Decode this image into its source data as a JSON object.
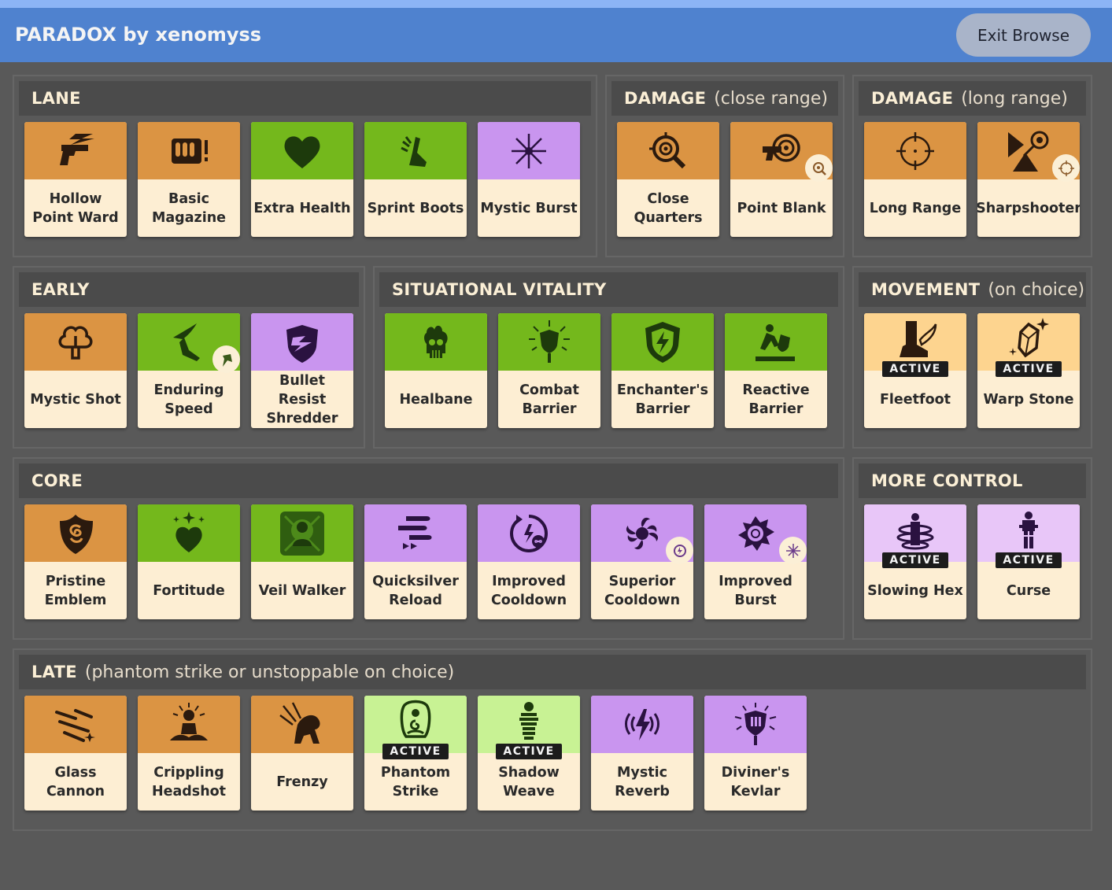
{
  "header": {
    "title": "PARADOX by xenomyss",
    "exit_label": "Exit Browse"
  },
  "active_label": "ACTIVE",
  "sections": {
    "lane": {
      "name": "LANE",
      "note": ""
    },
    "damage_close": {
      "name": "DAMAGE",
      "note": "(close range)"
    },
    "damage_long": {
      "name": "DAMAGE",
      "note": "(long range)"
    },
    "early": {
      "name": "EARLY",
      "note": ""
    },
    "situational": {
      "name": "SITUATIONAL VITALITY",
      "note": ""
    },
    "movement": {
      "name": "MOVEMENT",
      "note": "(on choice)"
    },
    "core": {
      "name": "CORE",
      "note": ""
    },
    "more_control": {
      "name": "MORE CONTROL",
      "note": ""
    },
    "late": {
      "name": "LATE",
      "note": "(phantom strike or unstoppable on choice)"
    }
  },
  "items": {
    "hollow_point_ward": {
      "name": "Hollow Point Ward",
      "category": "orange",
      "icon": "pistol-lightning-icon"
    },
    "basic_magazine": {
      "name": "Basic Magazine",
      "category": "orange",
      "icon": "magazine-icon"
    },
    "extra_health": {
      "name": "Extra Health",
      "category": "green",
      "icon": "heart-icon"
    },
    "sprint_boots": {
      "name": "Sprint Boots",
      "category": "green",
      "icon": "boot-icon"
    },
    "mystic_burst": {
      "name": "Mystic Burst",
      "category": "purple",
      "icon": "starburst-icon"
    },
    "close_quarters": {
      "name": "Close Quarters",
      "category": "orange",
      "icon": "magnifier-target-icon"
    },
    "point_blank": {
      "name": "Point Blank",
      "category": "orange",
      "icon": "gun-target-icon"
    },
    "long_range": {
      "name": "Long Range",
      "category": "orange",
      "icon": "crosshair-icon"
    },
    "sharpshooter": {
      "name": "Sharpshooter",
      "category": "orange",
      "icon": "sharpshooter-icon"
    },
    "mystic_shot": {
      "name": "Mystic Shot",
      "category": "orange",
      "icon": "mystic-shot-icon"
    },
    "enduring_speed": {
      "name": "Enduring Speed",
      "category": "green",
      "icon": "winged-foot-icon"
    },
    "bullet_resist_shredder": {
      "name": "Bullet Resist Shredder",
      "category": "purple",
      "icon": "broken-shield-icon"
    },
    "healbane": {
      "name": "Healbane",
      "category": "green",
      "icon": "skull-icon"
    },
    "combat_barrier": {
      "name": "Combat Barrier",
      "category": "green",
      "icon": "radiant-shield-icon"
    },
    "enchanters_barrier": {
      "name": "Enchanter's Barrier",
      "category": "green",
      "icon": "lightning-shield-icon"
    },
    "reactive_barrier": {
      "name": "Reactive Barrier",
      "category": "green",
      "icon": "falling-figure-icon"
    },
    "fleetfoot": {
      "name": "Fleetfoot",
      "category": "lightorange",
      "icon": "winged-boot-icon",
      "active": true
    },
    "warp_stone": {
      "name": "Warp Stone",
      "category": "lightorange",
      "icon": "warp-crystal-icon",
      "active": true
    },
    "pristine_emblem": {
      "name": "Pristine Emblem",
      "category": "orange",
      "icon": "emblem-shield-icon"
    },
    "fortitude": {
      "name": "Fortitude",
      "category": "green",
      "icon": "sparkle-heart-icon"
    },
    "veil_walker": {
      "name": "Veil Walker",
      "category": "green",
      "icon": "veiled-figure-icon"
    },
    "quicksilver_reload": {
      "name": "Quicksilver Reload",
      "category": "purple",
      "icon": "speeding-bullets-icon"
    },
    "improved_cooldown": {
      "name": "Improved Cooldown",
      "category": "purple",
      "icon": "cooldown-icon"
    },
    "superior_cooldown": {
      "name": "Superior Cooldown",
      "category": "purple",
      "icon": "swirl-cooldown-icon"
    },
    "improved_burst": {
      "name": "Improved Burst",
      "category": "purple",
      "icon": "burst-ring-icon"
    },
    "slowing_hex": {
      "name": "Slowing Hex",
      "category": "lightpurple",
      "icon": "hexed-figure-icon",
      "active": true
    },
    "curse": {
      "name": "Curse",
      "category": "lightpurple",
      "icon": "cursed-figure-icon",
      "active": true
    },
    "glass_cannon": {
      "name": "Glass Cannon",
      "category": "orange",
      "icon": "shattered-glass-icon"
    },
    "crippling_headshot": {
      "name": "Crippling Headshot",
      "category": "orange",
      "icon": "meditating-figure-icon"
    },
    "frenzy": {
      "name": "Frenzy",
      "category": "orange",
      "icon": "frenzy-beast-icon"
    },
    "phantom_strike": {
      "name": "Phantom Strike",
      "category": "lightgreen",
      "icon": "phantom-icon",
      "active": true
    },
    "shadow_weave": {
      "name": "Shadow Weave",
      "category": "lightgreen",
      "icon": "wrapped-figure-icon",
      "active": true
    },
    "mystic_reverb": {
      "name": "Mystic Reverb",
      "category": "purple",
      "icon": "reverb-bolt-icon"
    },
    "diviners_kevlar": {
      "name": "Diviner's Kevlar",
      "category": "purple",
      "icon": "radiant-kevlar-icon"
    }
  }
}
